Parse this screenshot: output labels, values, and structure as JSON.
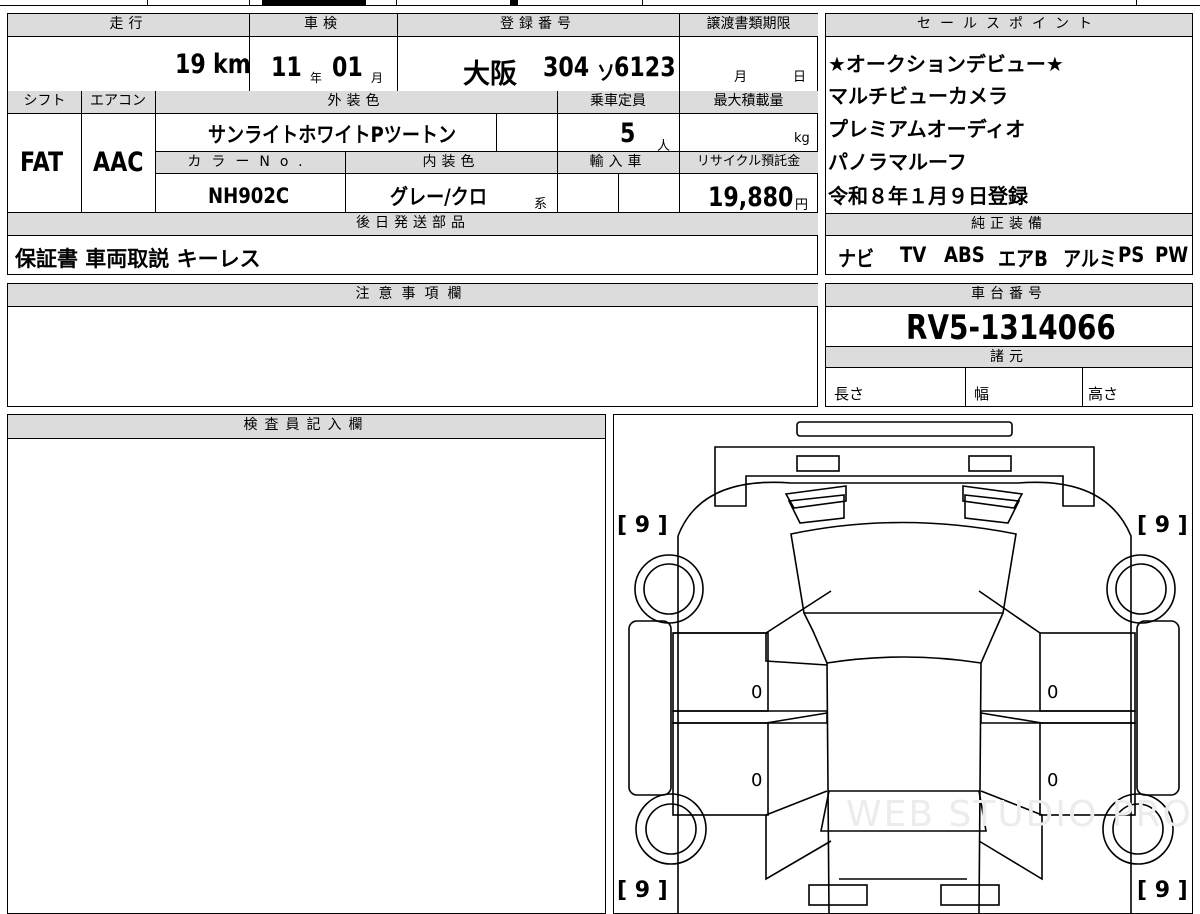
{
  "headers": {
    "mileage": "走行",
    "inspection": "車検",
    "registration": "登録番号",
    "transfer_deadline": "譲渡書類期限",
    "sales_points": "セールスポイント",
    "shift": "シフト",
    "aircon": "エアコン",
    "exterior_color": "外装色",
    "capacity": "乗車定員",
    "max_load": "最大積載量",
    "color_no": "カラーNo.",
    "interior_color": "内装色",
    "import": "輸入車",
    "recycle_fee": "リサイクル預託金",
    "accessories": "後日発送部品",
    "genuine_equipment": "純正装備",
    "notes": "注意事項欄",
    "chassis_no": "車台番号",
    "specs": "諸元",
    "inspector": "検査員記入欄"
  },
  "vehicle": {
    "mileage_value": "19",
    "mileage_unit": "km",
    "inspection_year": "11",
    "inspection_year_unit": "年",
    "inspection_month": "01",
    "inspection_month_unit": "月",
    "registration_region": "大阪",
    "registration_class": "304",
    "registration_kana": "ソ",
    "registration_number": "6123",
    "transfer_month_unit": "月",
    "transfer_day_unit": "日",
    "shift": "FAT",
    "aircon": "AAC",
    "exterior_color": "サンライトホワイトPツートン",
    "capacity": "5",
    "capacity_unit": "人",
    "max_load_unit": "kg",
    "color_no": "NH902C",
    "interior_color": "グレー/クロ",
    "interior_suffix": "系",
    "recycle_fee": "19,880",
    "recycle_unit": "円",
    "chassis_no": "RV5-1314066"
  },
  "accessories": "保証書 車両取説 キーレス",
  "sales_points": [
    "★オークションデビュー★",
    "マルチビューカメラ",
    "プレミアムオーディオ",
    "パノラマルーフ",
    "令和８年１月９日登録"
  ],
  "genuine_equipment": [
    "ナビ",
    "TV",
    "ABS",
    "エアB",
    "アルミ",
    "PS",
    "PW"
  ],
  "specs": {
    "length": "長さ",
    "width": "幅",
    "height": "高さ"
  },
  "diagram": {
    "tire_tl": "[ 9 ]",
    "tire_tr": "[ 9 ]",
    "tire_bl": "[ 9 ]",
    "tire_br": "[ 9 ]",
    "door_fl": "0",
    "door_fr": "0",
    "door_rl": "0",
    "door_rr": "0",
    "watermark": "WEB STUDIO PRO"
  }
}
